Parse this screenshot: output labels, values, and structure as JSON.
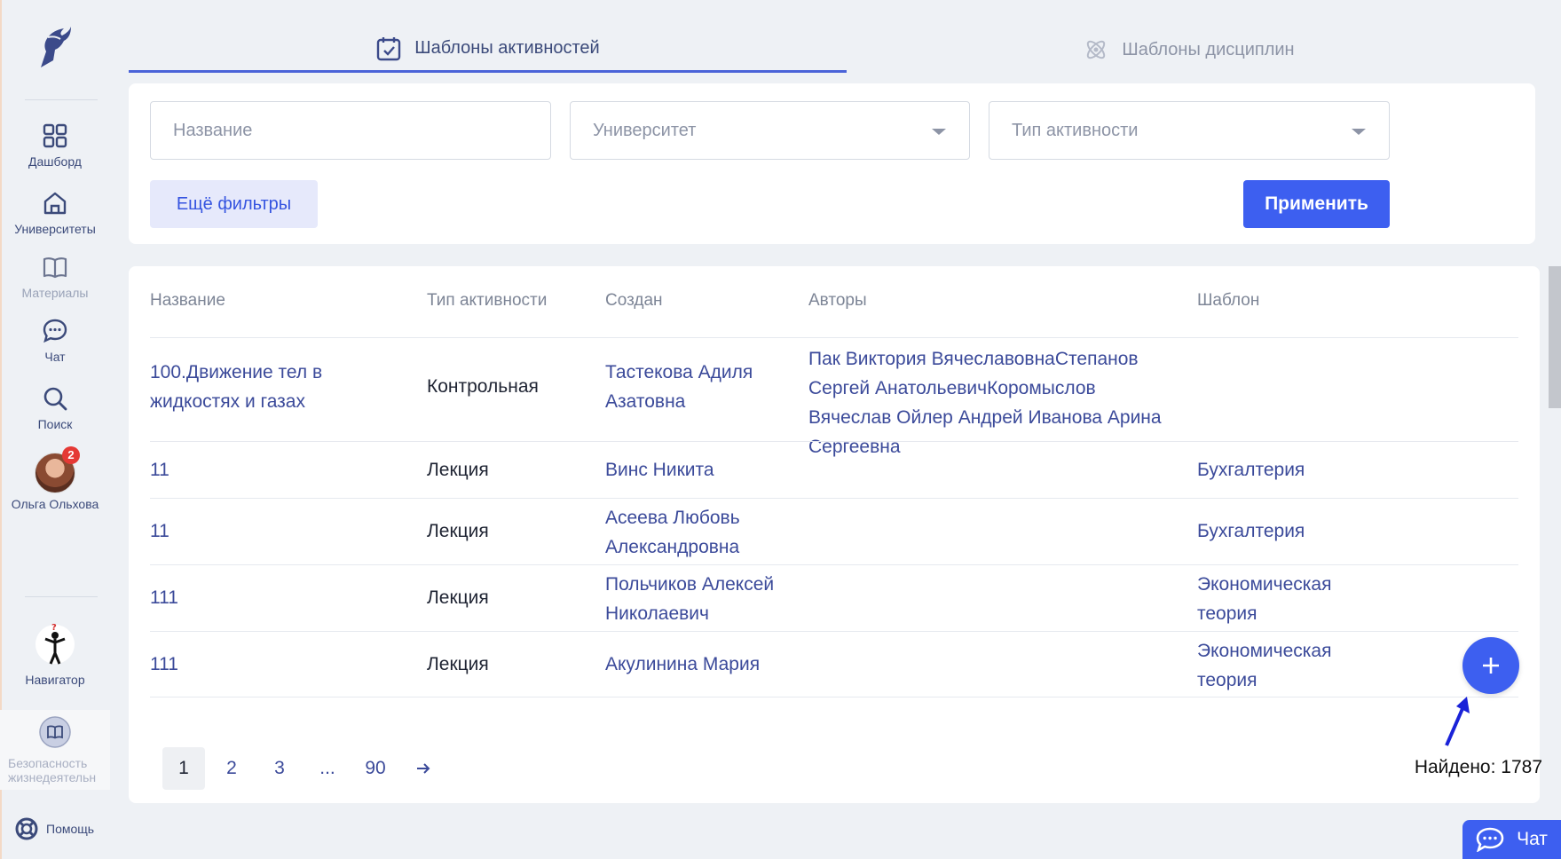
{
  "sidebar": {
    "items": [
      {
        "label": "Дашборд",
        "icon": "grid-icon"
      },
      {
        "label": "Университеты",
        "icon": "university-icon"
      },
      {
        "label": "Материалы",
        "icon": "book-icon"
      },
      {
        "label": "Чат",
        "icon": "chat-bubble-icon"
      },
      {
        "label": "Поиск",
        "icon": "search-icon"
      }
    ],
    "user": {
      "name": "Ольга Ольхова",
      "badge": "2"
    },
    "navigator_label": "Навигатор",
    "course_label": "Безопасность жизнедеятельн",
    "help_label": "Помощь"
  },
  "tabs": [
    {
      "label": "Шаблоны активностей",
      "icon": "calendar-check-icon",
      "active": true
    },
    {
      "label": "Шаблоны дисциплин",
      "icon": "atom-icon",
      "active": false
    }
  ],
  "filters": {
    "name_placeholder": "Название",
    "university_placeholder": "Университет",
    "type_placeholder": "Тип активности",
    "more_label": "Ещё фильтры",
    "apply_label": "Применить"
  },
  "table": {
    "headers": [
      "Название",
      "Тип активности",
      "Создан",
      "Авторы",
      "Шаблон"
    ],
    "rows": [
      {
        "name": "100.Движение тел в жидкостях и газах",
        "type": "Контрольная",
        "created": "Тастекова Адиля Азатовна",
        "authors": "Пак Виктория ВячеславовнаСтепанов Сергей АнатольевичКоромыслов Вячеслав Ойлер Андрей Иванова Арина Сергеевна",
        "template": ""
      },
      {
        "name": "11",
        "type": "Лекция",
        "created": "Винс Никита",
        "authors": "",
        "template": "Бухгалтерия"
      },
      {
        "name": "11",
        "type": "Лекция",
        "created": "Асеева Любовь Александровна",
        "authors": "",
        "template": "Бухгалтерия"
      },
      {
        "name": "111",
        "type": "Лекция",
        "created": "Польчиков Алексей Николаевич",
        "authors": "",
        "template": "Экономическая теория"
      },
      {
        "name": "111",
        "type": "Лекция",
        "created": "Акулинина Мария",
        "authors": "",
        "template": "Экономическая теория"
      }
    ]
  },
  "pagination": {
    "pages": [
      "1",
      "2",
      "3",
      "...",
      "90"
    ],
    "current": "1"
  },
  "found": "Найдено: 1787",
  "chat_button_label": "Чат",
  "colors": {
    "accent": "#3d5ff0",
    "link": "#3b4a9a",
    "background": "#eef1f5"
  }
}
